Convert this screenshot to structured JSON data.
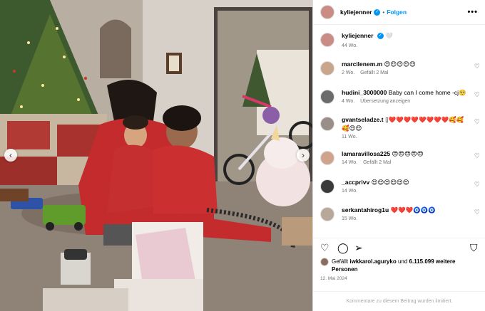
{
  "post": {
    "image_alt": "family in red pajamas by Christmas tree",
    "prev_icon": "chevron-left-icon",
    "next_icon": "chevron-right-icon"
  },
  "header": {
    "username": "kyliejenner",
    "separator": "•",
    "follow_label": "Folgen",
    "more_icon": "•••"
  },
  "caption": {
    "username": "kyliejenner",
    "text": "🤍",
    "time": "44 Wo."
  },
  "comments": [
    {
      "username": "marcilenem.m",
      "text": "😍😍😍😍😍",
      "time": "2 Wo.",
      "likes": "Gefällt 2 Mal",
      "avatar_color": "#c9a58a"
    },
    {
      "username": "hudini_3000000",
      "text": "Baby can I come home -cj🥺",
      "time": "4 Wo.",
      "likes": "Übersetzung anzeigen",
      "avatar_color": "#6b6b6b"
    },
    {
      "username": "gvantseladze.t",
      "text": "▯❤️❤️❤️❤️❤️❤️❤️❤️🥰🥰🥰😍😍",
      "time": "11 Wo.",
      "likes": "",
      "avatar_color": "#9a8f88"
    },
    {
      "username": "lamaravillosa225",
      "text": "😍😍😍😍😍",
      "time": "14 Wo.",
      "likes": "Gefällt 2 Mal",
      "avatar_color": "#d0a48c"
    },
    {
      "username": "_accprivv",
      "text": "😍😍😍😍😍😍",
      "time": "14 Wo.",
      "likes": "",
      "avatar_color": "#3a3a3a"
    },
    {
      "username": "serkantahirog1u",
      "text": "❤️❤️❤️🧿🧿🧿",
      "time": "15 Wo.",
      "likes": "",
      "avatar_color": "#b8a89a"
    }
  ],
  "actions": {
    "like_icon": "♡",
    "comment_icon": "◯",
    "share_icon": "➢",
    "save_icon": "⛉"
  },
  "likes_line": {
    "prefix": "Gefällt",
    "user": "iwkkarol.aguryko",
    "middle": "und",
    "count": "6.115.099 weitere Personen"
  },
  "date": "12. Mai 2024",
  "comments_limited": "Kommentare zu diesem Beitrag wurden limitiert.",
  "colors": {
    "accent": "#0095f6",
    "meta": "#737373"
  }
}
